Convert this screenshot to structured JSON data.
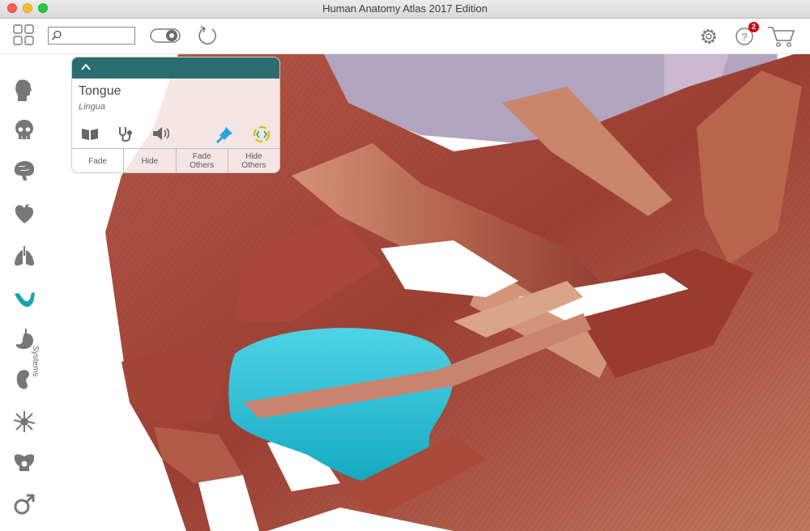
{
  "window": {
    "title": "Human Anatomy Atlas 2017 Edition"
  },
  "toolbar": {
    "search_placeholder": "",
    "help_badge_count": "2",
    "icons": [
      "grid-icon",
      "search-icon",
      "toggle-icon",
      "reset-icon",
      "gear-icon",
      "help-icon",
      "cart-icon"
    ]
  },
  "sidebar": {
    "label": "Systems",
    "items": [
      "head-icon",
      "skull-icon",
      "brain-icon",
      "heart-icon",
      "lungs-icon",
      "muscle-icon",
      "stomach-icon",
      "kidney-icon",
      "nerve-cell-icon",
      "pelvis-icon",
      "male-symbol-icon"
    ],
    "active": "muscle-icon",
    "active_color": "#1aa3b0"
  },
  "panel": {
    "title": "Tongue",
    "subtitle": "Lingua",
    "buttons": [
      "Fade",
      "Hide",
      "Fade\nOthers",
      "Hide\nOthers"
    ],
    "header_color": "#2a6d70",
    "pin_color": "#29a3e0"
  },
  "model": {
    "selected_structure": "Tongue",
    "highlight_color": "#21b6cc",
    "muscle_color": "#a5483c"
  }
}
